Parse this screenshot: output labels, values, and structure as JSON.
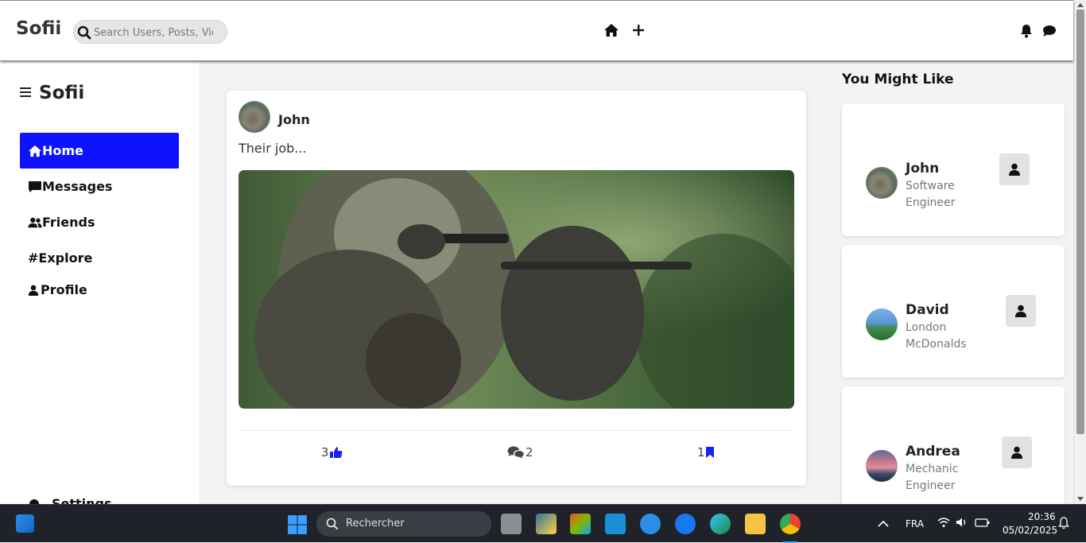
{
  "header": {
    "brand": "Sofii",
    "search_placeholder": "Search Users, Posts, Videos"
  },
  "sidebar": {
    "brand": "Sofii",
    "items": [
      {
        "label": "Home"
      },
      {
        "label": "Messages"
      },
      {
        "label": "Friends"
      },
      {
        "label": "#Explore"
      },
      {
        "label": "Profile"
      }
    ],
    "settings_label": "Settings"
  },
  "post": {
    "author": "John",
    "text": "Their job...",
    "likes": "3",
    "comments": "2",
    "saves": "1"
  },
  "suggestions": {
    "title": "You Might Like",
    "people": [
      {
        "name": "John",
        "line1": "Software",
        "line2": "Engineer"
      },
      {
        "name": "David",
        "line1": "London",
        "line2": "McDonalds"
      },
      {
        "name": "Andrea",
        "line1": "Mechanic",
        "line2": "Engineer"
      }
    ]
  },
  "taskbar": {
    "search_label": "Rechercher",
    "language": "FRA",
    "time": "20:36",
    "date": "05/02/2025"
  },
  "colors": {
    "accent": "#0f12ff",
    "like_icon": "#1c22f0",
    "taskbar_bg": "#1f2329"
  }
}
